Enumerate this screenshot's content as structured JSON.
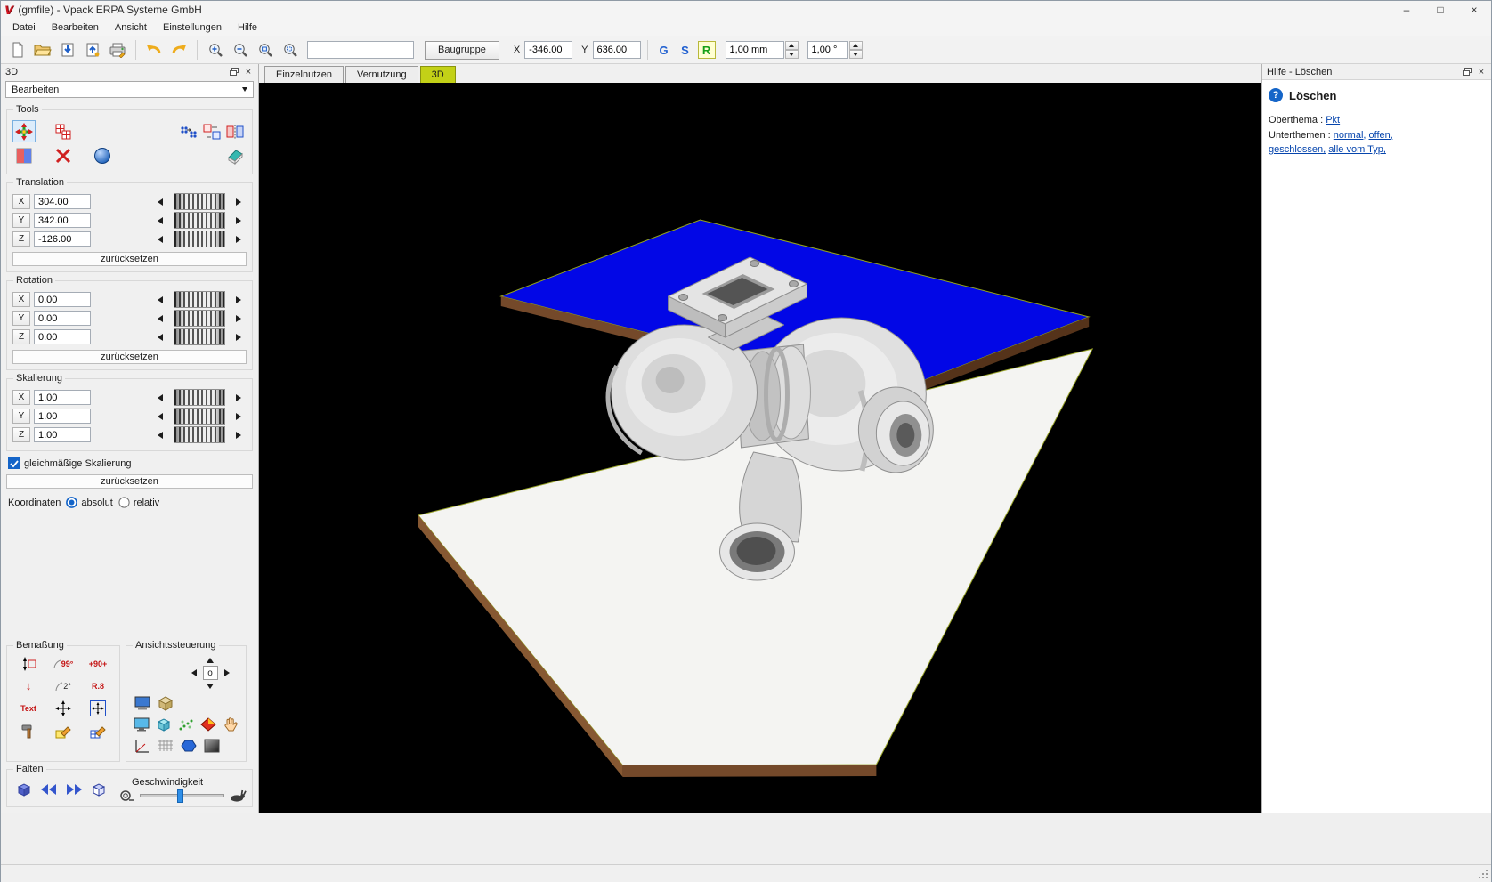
{
  "window": {
    "logo": "V",
    "title": "(gmfile) - Vpack ERPA Systeme GmbH"
  },
  "icons": {
    "minimize": "–",
    "maximize": "□",
    "close": "×",
    "help": "?",
    "down_arrow": "↓",
    "updown_arrow": "↕"
  },
  "menubar": {
    "items": [
      "Datei",
      "Bearbeiten",
      "Ansicht",
      "Einstellungen",
      "Hilfe"
    ]
  },
  "toolbar": {
    "filter_value": "",
    "baugruppe": "Baugruppe",
    "coord_x_label": "X",
    "coord_x_value": "-346.00",
    "coord_y_label": "Y",
    "coord_y_value": "636.00",
    "g": "G",
    "s": "S",
    "r": "R",
    "step_mm": "1,00 mm",
    "step_deg": "1,00 °"
  },
  "tabs": [
    {
      "label": "Einzelnutzen"
    },
    {
      "label": "Vernutzung"
    },
    {
      "label": "3D"
    }
  ],
  "left_panel": {
    "title": "3D",
    "mode": "Bearbeiten",
    "tools_label": "Tools",
    "translation": {
      "label": "Translation",
      "rows": [
        {
          "axis": "X",
          "value": "304.00"
        },
        {
          "axis": "Y",
          "value": "342.00"
        },
        {
          "axis": "Z",
          "value": "-126.00"
        }
      ],
      "reset": "zurücksetzen"
    },
    "rotation": {
      "label": "Rotation",
      "rows": [
        {
          "axis": "X",
          "value": "0.00"
        },
        {
          "axis": "Y",
          "value": "0.00"
        },
        {
          "axis": "Z",
          "value": "0.00"
        }
      ],
      "reset": "zurücksetzen"
    },
    "scaling": {
      "label": "Skalierung",
      "rows": [
        {
          "axis": "X",
          "value": "1.00"
        },
        {
          "axis": "Y",
          "value": "1.00"
        },
        {
          "axis": "Z",
          "value": "1.00"
        }
      ],
      "uniform": "gleichmäßige Skalierung",
      "reset": "zurücksetzen"
    },
    "coordinates": {
      "label": "Koordinaten",
      "absolute": "absolut",
      "relative": "relativ"
    },
    "bemassung": {
      "label": "Bemaßung",
      "angle_badge": "99°",
      "rot_badge": "+90+",
      "angle2_badge": "2°",
      "radius_badge": "R.8",
      "text_badge": "Text"
    },
    "ansicht": {
      "label": "Ansichtssteuerung",
      "center": "o"
    },
    "falten": {
      "label": "Falten",
      "speed_label": "Geschwindigkeit"
    }
  },
  "help_panel": {
    "title": "Hilfe - Löschen",
    "heading": "Löschen",
    "oberthema_label": "Oberthema :",
    "oberthema_link": "Pkt",
    "unterthemen_label": "Unterthemen :",
    "links": [
      "normal,",
      "offen,",
      "geschlossen,",
      "alle vom Typ,"
    ]
  },
  "viewport": {
    "board_blue": "#0207e6",
    "board_white": "#f4f4f2",
    "edge_color": "#74492a"
  }
}
